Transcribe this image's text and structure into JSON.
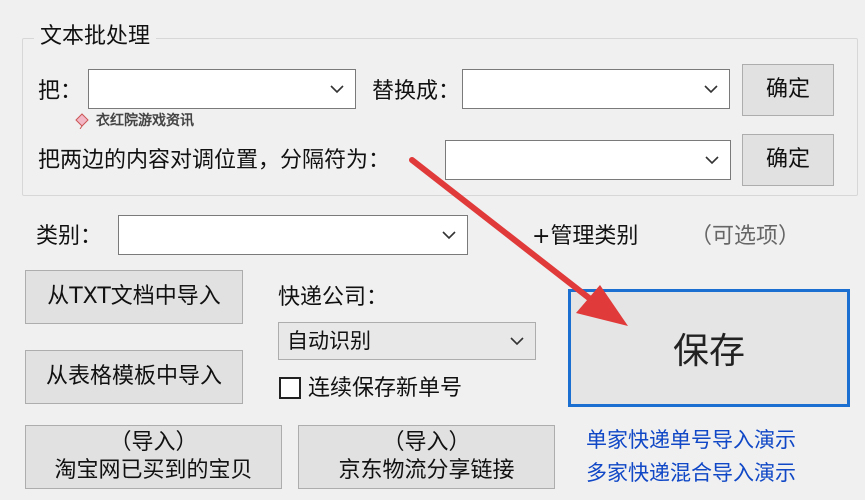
{
  "group": {
    "title": "文本批处理",
    "replace_from_label": "把：",
    "replace_to_label": "替换成：",
    "confirm1": "确定",
    "swap_label": "把两边的内容对调位置，分隔符为：",
    "confirm2": "确定",
    "replace_from_value": "",
    "replace_to_value": "",
    "separator_value": ""
  },
  "watermark": "衣红院游戏资讯",
  "category": {
    "label": "类别：",
    "value": "",
    "manage": "+管理类别",
    "optional": "（可选项）"
  },
  "imports": {
    "txt": "从TXT文档中导入",
    "template": "从表格模板中导入",
    "taobao_line1": "（导入）",
    "taobao_line2": "淘宝网已买到的宝贝",
    "jd_line1": "（导入）",
    "jd_line2": "京东物流分享链接"
  },
  "courier": {
    "label": "快递公司：",
    "selected": "自动识别"
  },
  "continuous_save": {
    "label": "连续保存新单号",
    "checked": false
  },
  "save_button": "保存",
  "links": {
    "single": "单家快递单号导入演示",
    "multi": "多家快递混合导入演示"
  },
  "colors": {
    "accent": "#1a6fd1",
    "link": "#0f47c6",
    "arrow": "#e03a3a"
  }
}
